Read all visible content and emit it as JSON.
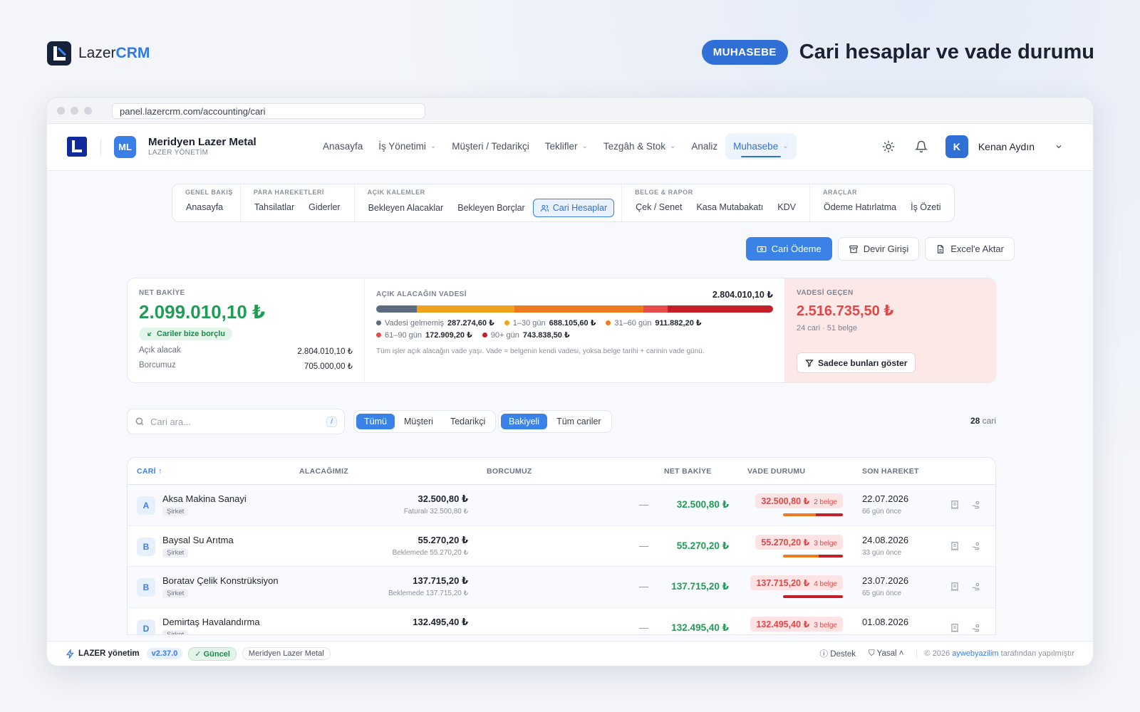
{
  "brand": {
    "light": "Lazer",
    "bold": "CRM"
  },
  "module_pill": "MUHASEBE",
  "page_heading": "Cari hesaplar ve vade durumu",
  "browser": {
    "url": "panel.lazercrm.com/accounting/cari"
  },
  "appbar": {
    "company_initials": "ML",
    "company_name": "Meridyen Lazer Metal",
    "company_sub": "LAZER YÖNETİM",
    "nav": [
      {
        "label": "Anasayfa"
      },
      {
        "label": "İş Yönetimi",
        "dropdown": true
      },
      {
        "label": "Müşteri / Tedarikçi"
      },
      {
        "label": "Teklifler",
        "dropdown": true
      },
      {
        "label": "Tezgâh & Stok",
        "dropdown": true
      },
      {
        "label": "Analiz"
      },
      {
        "label": "Muhasebe",
        "dropdown": true,
        "active": true
      }
    ],
    "user_initial": "K",
    "user_name": "Kenan Aydın"
  },
  "subnav": {
    "groups": [
      {
        "title": "GENEL BAKIŞ",
        "items": [
          "Anasayfa"
        ]
      },
      {
        "title": "PARA HAREKETLERİ",
        "items": [
          "Tahsilatlar",
          "Giderler"
        ]
      },
      {
        "title": "AÇIK KALEMLER",
        "items": [
          "Bekleyen Alacaklar",
          "Bekleyen Borçlar",
          "Cari Hesaplar"
        ]
      },
      {
        "title": "BELGE & RAPOR",
        "items": [
          "Çek / Senet",
          "Kasa Mutabakatı",
          "KDV"
        ]
      },
      {
        "title": "ARAÇLAR",
        "items": [
          "Ödeme Hatırlatma",
          "İş Özeti"
        ]
      }
    ],
    "active": "Cari Hesaplar"
  },
  "actions": {
    "pay": "Cari Ödeme",
    "opening": "Devir Girişi",
    "export": "Excel'e Aktar"
  },
  "summary": {
    "net_label": "NET BAKİYE",
    "net_value": "2.099.010,10 ₺",
    "net_chip": "Cariler bize borçlu",
    "open_receivable_label": "Açık alacak",
    "open_receivable_value": "2.804.010,10 ₺",
    "our_debt_label": "Borcumuz",
    "our_debt_value": "705.000,00 ₺",
    "aging_label": "AÇIK ALACAĞIN VADESİ",
    "aging_total": "2.804.010,10 ₺",
    "aging_buckets": [
      {
        "label": "Vadesi gelmemiş",
        "value_text": "287.274,60 ₺",
        "value": 287274.6,
        "color": "#5d6b80"
      },
      {
        "label": "1–30 gün",
        "value_text": "688.105,60 ₺",
        "value": 688105.6,
        "color": "#f0a21c"
      },
      {
        "label": "31–60 gün",
        "value_text": "911.882,20 ₺",
        "value": 911882.2,
        "color": "#ec7a1e"
      },
      {
        "label": "61–90 gün",
        "value_text": "172.909,20 ₺",
        "value": 172909.2,
        "color": "#e84b4b"
      },
      {
        "label": "90+ gün",
        "value_text": "743.838,50 ₺",
        "value": 743838.5,
        "color": "#c21f28"
      }
    ],
    "aging_note": "Tüm işler açık alacağın vade yaşı. Vade = belgenin kendi vadesi, yoksa belge tarihi + carinin vade günü.",
    "overdue_label": "VADESİ GEÇEN",
    "overdue_value": "2.516.735,50 ₺",
    "overdue_sub": "24 cari · 51 belge",
    "overdue_button": "Sadece bunları göster"
  },
  "filters": {
    "search_placeholder": "Cari ara...",
    "search_key": "/",
    "type_options": [
      "Tümü",
      "Müşteri",
      "Tedarikçi"
    ],
    "type_active": "Tümü",
    "balance_options": [
      "Bakiyeli",
      "Tüm cariler"
    ],
    "balance_active": "Bakiyeli",
    "count_number": "28",
    "count_unit": "cari"
  },
  "table": {
    "headers": {
      "cari": "CARİ",
      "receivable": "ALACAĞIMIZ",
      "debt": "BORCUMUZ",
      "net": "NET BAKİYE",
      "due": "VADE DURUMU",
      "last": "SON HAREKET"
    },
    "rows": [
      {
        "initial": "A",
        "name": "Aksa Makina Sanayi",
        "type": "Şirket",
        "receivable": "32.500,80 ₺",
        "receivable_sub": "Faturalı 32.500,80 ₺",
        "debt": "—",
        "net": "32.500,80 ₺",
        "due_amount": "32.500,80 ₺",
        "due_docs": "2 belge",
        "due_split": [
          0.55,
          0.45
        ],
        "date": "22.07.2026",
        "ago": "66 gün önce"
      },
      {
        "initial": "B",
        "name": "Baysal Su Arıtma",
        "type": "Şirket",
        "receivable": "55.270,20 ₺",
        "receivable_sub": "Beklemede 55.270,20 ₺",
        "debt": "—",
        "net": "55.270,20 ₺",
        "due_amount": "55.270,20 ₺",
        "due_docs": "3 belge",
        "due_split": [
          0.6,
          0.4
        ],
        "date": "24.08.2026",
        "ago": "33 gün önce"
      },
      {
        "initial": "B",
        "name": "Boratav Çelik Konstrüksiyon",
        "type": "Şirket",
        "receivable": "137.715,20 ₺",
        "receivable_sub": "Beklemede 137.715,20 ₺",
        "debt": "—",
        "net": "137.715,20 ₺",
        "due_amount": "137.715,20 ₺",
        "due_docs": "4 belge",
        "due_split": [
          0.0,
          1.0
        ],
        "date": "23.07.2026",
        "ago": "65 gün önce"
      },
      {
        "initial": "D",
        "name": "Demirtaş Havalandırma",
        "type": "Şirket",
        "receivable": "132.495,40 ₺",
        "receivable_sub": "",
        "debt": "—",
        "net": "132.495,40 ₺",
        "due_amount": "132.495,40 ₺",
        "due_docs": "3 belge",
        "due_split": [
          0.5,
          0.5
        ],
        "date": "01.08.2026",
        "ago": ""
      }
    ]
  },
  "footer": {
    "brand": "LAZER yönetim",
    "version": "v2.37.0",
    "status": "Güncel",
    "company": "Meridyen Lazer Metal",
    "support": "Destek",
    "legal": "Yasal",
    "copy_prefix": "© 2026",
    "copy_link": "aywebyazilim",
    "copy_suffix": "tarafından yapılmıştır"
  }
}
